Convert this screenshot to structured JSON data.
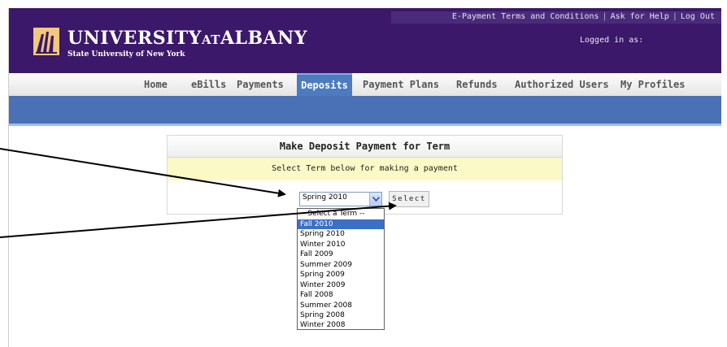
{
  "header": {
    "top_links": [
      "E-Payment Terms and Conditions",
      "Ask for Help",
      "Log Out"
    ],
    "separator": "|",
    "university_prefix": "UNIVERSITY",
    "university_at": "AT",
    "university_name": "ALBANY",
    "university_sub": "State University of New York",
    "logged_in": "Logged in as:"
  },
  "nav": {
    "tabs": [
      "Home",
      "eBills",
      "Payments",
      "Deposits",
      "Payment Plans",
      "Refunds",
      "Authorized Users",
      "My Profiles"
    ],
    "active": "Deposits"
  },
  "panel": {
    "title": "Make Deposit Payment for Term",
    "instruction": "Select Term below for making a payment",
    "select_value": "Spring 2010",
    "button": "Select"
  },
  "dropdown": {
    "options": [
      "-- Select a Term --",
      "Fall 2010",
      "Spring 2010",
      "Winter 2010",
      "Fall 2009",
      "Summer 2009",
      "Spring 2009",
      "Winter 2009",
      "Fall 2008",
      "Summer 2008",
      "Spring 2008",
      "Winter 2008"
    ],
    "highlighted": "Fall 2010"
  },
  "colors": {
    "header": "#3b1869",
    "nav_active": "#4c7cbf",
    "blue_bar": "#4a70b5",
    "instruction_bg": "#fbf9c6",
    "option_highlight": "#3b6fc8"
  },
  "icons": {
    "logo": "university-seal-icon",
    "dropdown_arrow": "chevron-down-icon"
  }
}
